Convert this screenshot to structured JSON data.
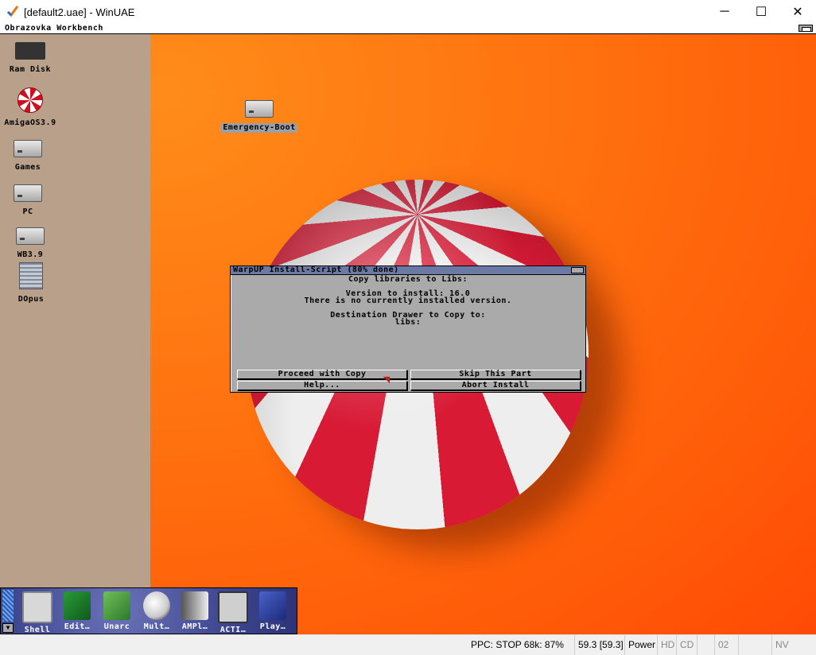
{
  "window": {
    "title": "[default2.uae] - WinUAE",
    "app_icon": "winuae-checkmark-icon",
    "controls": {
      "minimize": "─",
      "maximize": "☐",
      "close": "✕"
    }
  },
  "screen": {
    "title": "Obrazovka Workbench"
  },
  "desktop_icons": [
    {
      "label": "Ram Disk",
      "icon": "ram-chip-icon"
    },
    {
      "label": "AmigaOS3.9",
      "icon": "boing-disk-icon"
    },
    {
      "label": "Games",
      "icon": "harddrive-icon"
    },
    {
      "label": "PC",
      "icon": "harddrive-icon"
    },
    {
      "label": "WB3.9",
      "icon": "harddrive-icon"
    },
    {
      "label": "DOpus",
      "icon": "dopus-icon"
    },
    {
      "label": "Emergency-Boot",
      "icon": "boot-drive-icon"
    }
  ],
  "dialog": {
    "title": "WarpUP Install-Script (80% done)",
    "progress": 0.8,
    "lines": [
      "Copy libraries to Libs:",
      "Version to install: 16.0",
      "There is no currently installed version.",
      "Destination Drawer to Copy to:",
      "libs:"
    ],
    "buttons": {
      "proceed": "Proceed with Copy",
      "skip": "Skip This Part",
      "help": "Help...",
      "abort": "Abort Install"
    }
  },
  "dock": {
    "items": [
      {
        "label": "Shell"
      },
      {
        "label": "Edit…"
      },
      {
        "label": "Unarc"
      },
      {
        "label": "Mult…"
      },
      {
        "label": "AMPl…"
      },
      {
        "label": "ACTI…"
      },
      {
        "label": "Play…"
      }
    ],
    "arrow": "▼"
  },
  "statusbar": {
    "ppc": "PPC: STOP 68k: 87%",
    "fps": "59.3 [59.3]",
    "power": "Power",
    "hd": "HD",
    "cd": "CD",
    "drive": "02",
    "nv": "NV"
  },
  "colors": {
    "desktop_orange": "#ff7410",
    "left_panel": "#b8a08a",
    "dialog_gray": "#aaaaaa",
    "dialog_title_blue": "#6b7aa5",
    "boing_red": "#d81a35"
  }
}
